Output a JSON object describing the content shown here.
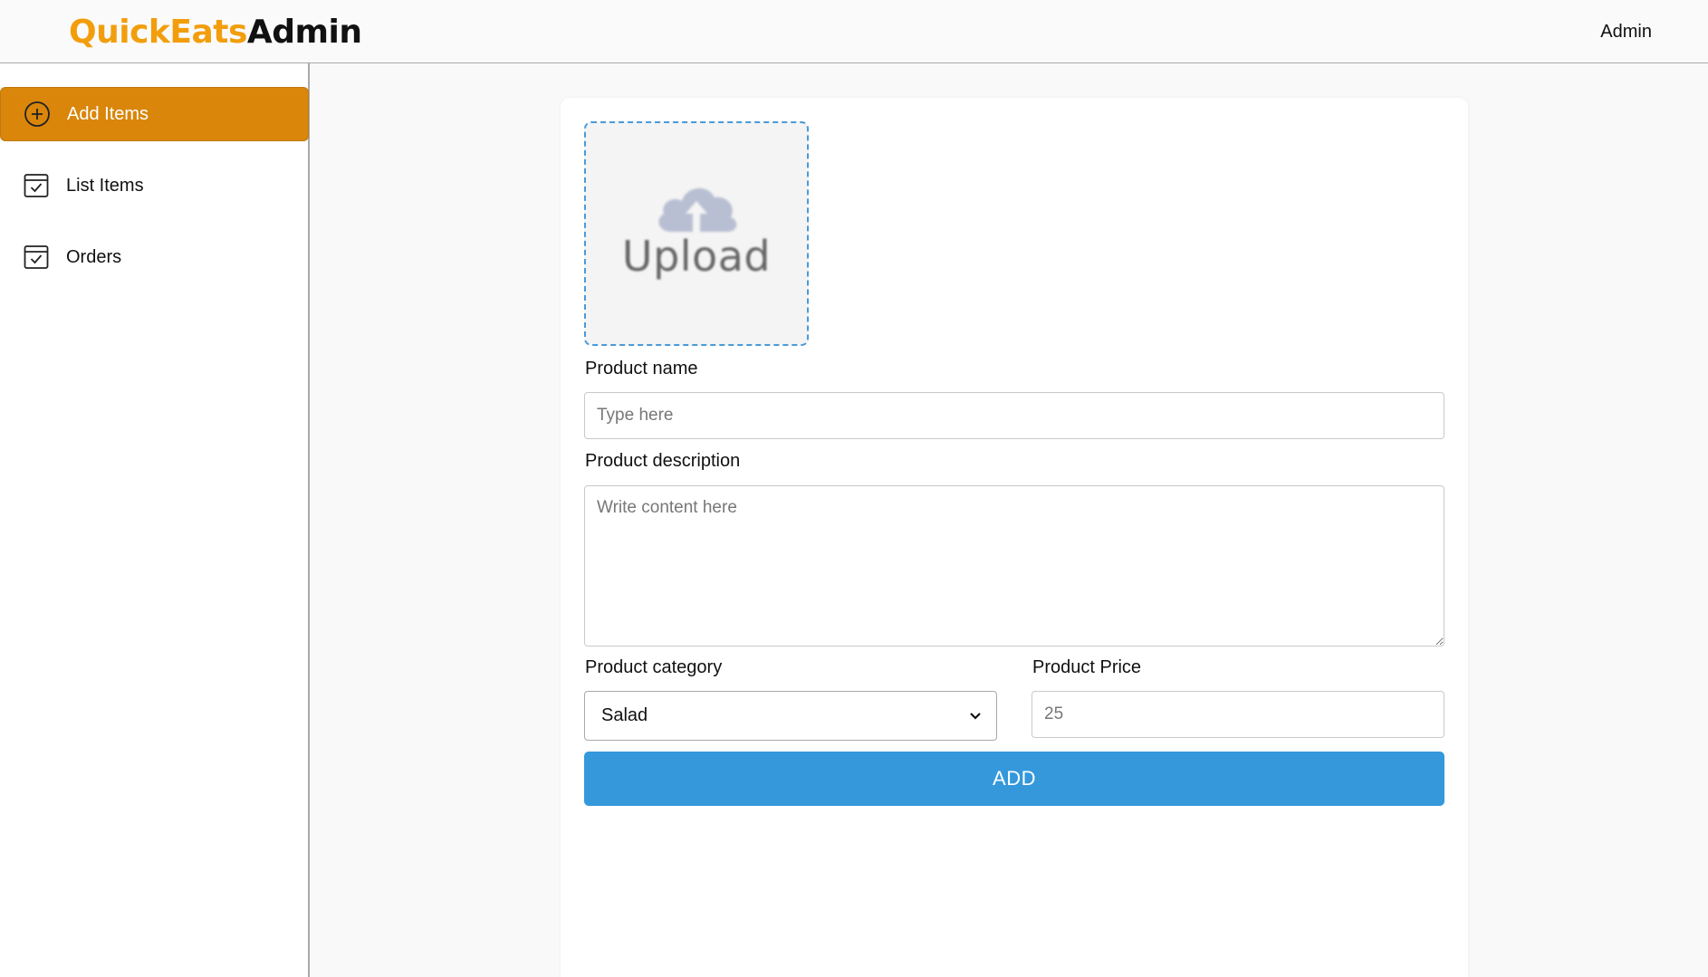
{
  "header": {
    "logo_brand": "QuickEats",
    "logo_suffix": "Admin",
    "admin_label": "Admin"
  },
  "sidebar": {
    "items": [
      {
        "label": "Add Items",
        "icon": "add-circle-icon",
        "active": true
      },
      {
        "label": "List Items",
        "icon": "calendar-check-icon",
        "active": false
      },
      {
        "label": "Orders",
        "icon": "calendar-check-icon",
        "active": false
      }
    ]
  },
  "form": {
    "upload_label": "Upload",
    "product_name_label": "Product name",
    "product_name_placeholder": "Type here",
    "product_description_label": "Product description",
    "product_description_placeholder": "Write content here",
    "product_category_label": "Product category",
    "product_category_value": "Salad",
    "product_price_label": "Product Price",
    "product_price_placeholder": "25",
    "add_button_label": "ADD"
  },
  "colors": {
    "brand_orange": "#f29e0c",
    "active_sidebar": "#d9860a",
    "primary_blue": "#3498db",
    "upload_border": "#4a9ad8"
  }
}
